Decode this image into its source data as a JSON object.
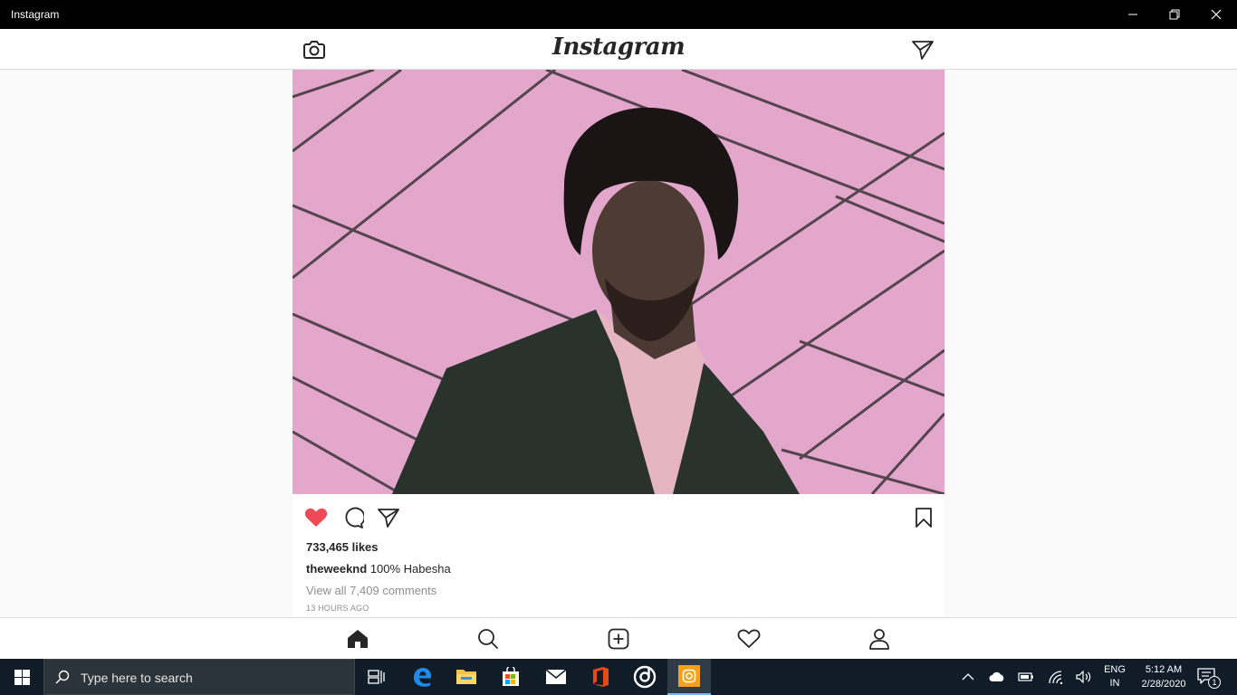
{
  "window": {
    "title": "Instagram",
    "controls": [
      "minimize-icon",
      "restore-icon",
      "close-icon"
    ]
  },
  "header": {
    "logo_text": "Instagram",
    "left_icon": "camera-icon",
    "right_icon": "direct-message-icon"
  },
  "post": {
    "image_icon": "post-photo",
    "liked": true,
    "like_color": "#ed4956",
    "likes_text": "733,465 likes",
    "username": "theweeknd",
    "caption": "100% Habesha",
    "comments_link": "View all 7,409 comments",
    "timestamp": "13 HOURS AGO"
  },
  "bottom_nav": {
    "items": [
      "home-icon",
      "search-icon",
      "add-post-icon",
      "activity-heart-icon",
      "profile-icon"
    ],
    "active": "home-icon"
  },
  "taskbar": {
    "search_placeholder": "Type here to search",
    "apps": [
      "task-view-icon",
      "edge-icon",
      "file-explorer-icon",
      "store-icon",
      "mail-icon",
      "office-icon",
      "groove-icon",
      "instagram-icon"
    ],
    "active_app": "instagram-icon",
    "language_line1": "ENG",
    "language_line2": "IN",
    "time": "5:12 AM",
    "date": "2/28/2020",
    "notification_count": "1"
  },
  "colors": {
    "titlebar": "#000000",
    "taskbar": "#101d29",
    "photo_pink": "#e3a7cb",
    "text_primary": "#262626",
    "text_secondary": "#8e8e8e"
  }
}
